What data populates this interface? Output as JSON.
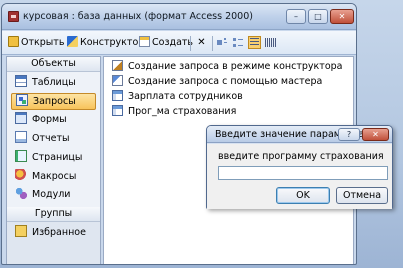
{
  "window": {
    "title": "курсовая : база данных (формат Access 2000)",
    "minimize": "–",
    "maximize": "□",
    "close": "✕"
  },
  "toolbar": {
    "open_label": "Открыть",
    "design_label": "Конструктор",
    "create_label": "Создать",
    "delete_glyph": "✕"
  },
  "sidebar": {
    "objects_header": "Объекты",
    "items": [
      {
        "label": "Таблицы",
        "icon": "table-icon"
      },
      {
        "label": "Запросы",
        "icon": "query-icon"
      },
      {
        "label": "Формы",
        "icon": "form-icon"
      },
      {
        "label": "Отчеты",
        "icon": "report-icon"
      },
      {
        "label": "Страницы",
        "icon": "page-icon"
      },
      {
        "label": "Макросы",
        "icon": "macro-icon"
      },
      {
        "label": "Модули",
        "icon": "module-icon"
      }
    ],
    "selected_index": 1,
    "groups_header": "Группы",
    "favorites_label": "Избранное"
  },
  "list": {
    "items": [
      {
        "label": "Создание запроса в режиме конструктора",
        "icon": "query-design-icon"
      },
      {
        "label": "Создание запроса с помощью мастера",
        "icon": "query-wizard-icon"
      },
      {
        "label": "Зарплата сотрудников",
        "icon": "query-icon"
      },
      {
        "label": "Прог_ма страхования",
        "icon": "query-icon"
      }
    ]
  },
  "dialog": {
    "title": "Введите значение параметра",
    "help": "?",
    "close": "✕",
    "prompt": "введите программу страхования",
    "input_value": "",
    "ok_label": "OK",
    "cancel_label": "Отмена"
  },
  "colors": {
    "selection": "#f8c35b",
    "titlebar": "#bfd1ea",
    "close_button": "#c0503a"
  }
}
